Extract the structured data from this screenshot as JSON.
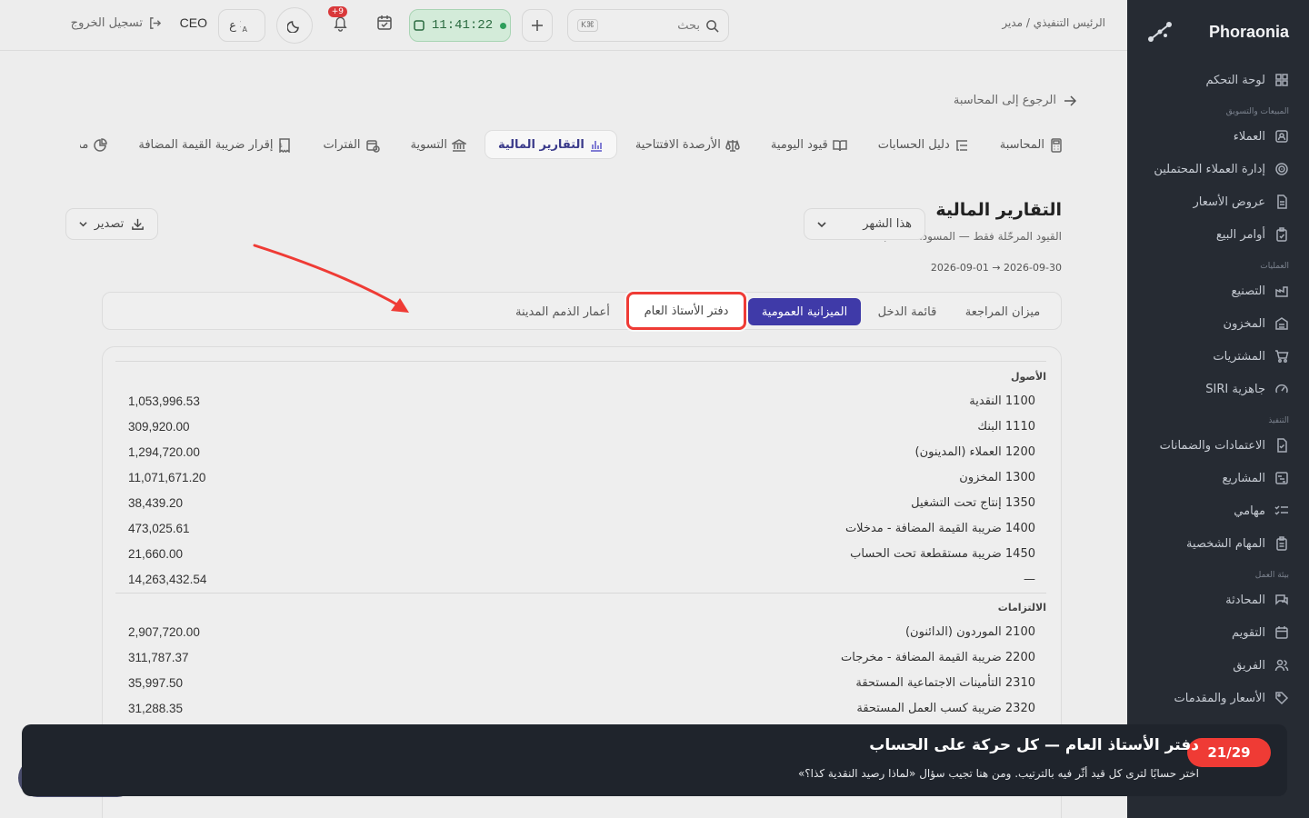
{
  "brand": {
    "name": "Phoraonia"
  },
  "sidebar": {
    "items": [
      {
        "type": "item",
        "label": "لوحة التحكم",
        "icon": "grid-icon"
      },
      {
        "type": "section",
        "label": "المبيعات والتسويق"
      },
      {
        "type": "item",
        "label": "العملاء",
        "icon": "contact-icon"
      },
      {
        "type": "item",
        "label": "إدارة العملاء المحتملين",
        "icon": "target-icon"
      },
      {
        "type": "item",
        "label": "عروض الأسعار",
        "icon": "document-icon"
      },
      {
        "type": "item",
        "label": "أوامر البيع",
        "icon": "clipboard-icon"
      },
      {
        "type": "section",
        "label": "العمليات"
      },
      {
        "type": "item",
        "label": "التصنيع",
        "icon": "factory-icon"
      },
      {
        "type": "item",
        "label": "المخزون",
        "icon": "warehouse-icon"
      },
      {
        "type": "item",
        "label": "المشتريات",
        "icon": "cart-icon"
      },
      {
        "type": "item",
        "label": "جاهزية SIRI",
        "icon": "gauge-icon"
      },
      {
        "type": "section",
        "label": "التنفيذ"
      },
      {
        "type": "item",
        "label": "الاعتمادات والضمانات",
        "icon": "file-check-icon"
      },
      {
        "type": "item",
        "label": "المشاريع",
        "icon": "gantt-icon"
      },
      {
        "type": "item",
        "label": "مهامي",
        "icon": "list-check-icon"
      },
      {
        "type": "item",
        "label": "المهام الشخصية",
        "icon": "clipboard-list-icon"
      },
      {
        "type": "section",
        "label": "بيئة العمل"
      },
      {
        "type": "item",
        "label": "المحادثة",
        "icon": "chat-icon"
      },
      {
        "type": "item",
        "label": "التقويم",
        "icon": "calendar-icon"
      },
      {
        "type": "item",
        "label": "الفريق",
        "icon": "users-icon"
      },
      {
        "type": "item",
        "label": "الأسعار والمقدمات",
        "icon": "tag-icon"
      }
    ]
  },
  "topbar": {
    "breadcrumb": "الرئيس التنفيذي / مدير",
    "search_placeholder": "بحث",
    "search_shortcut": "K⌘",
    "clock": "11:41:22",
    "notif_count": "+9",
    "lang": "ع",
    "role": "CEO",
    "logout": "تسجيل الخروج"
  },
  "nav": {
    "back": "الرجوع إلى المحاسبة",
    "tabs": [
      {
        "label": "المحاسبة",
        "icon": "calculator-icon",
        "active": false
      },
      {
        "label": "دليل الحسابات",
        "icon": "list-tree-icon",
        "active": false
      },
      {
        "label": "قيود اليومية",
        "icon": "book-icon",
        "active": false
      },
      {
        "label": "الأرصدة الافتتاحية",
        "icon": "scale-icon",
        "active": false
      },
      {
        "label": "التقارير المالية",
        "icon": "bar-chart-icon",
        "active": true
      },
      {
        "label": "التسوية",
        "icon": "bank-icon",
        "active": false
      },
      {
        "label": "الفترات",
        "icon": "calendar-clock-icon",
        "active": false
      },
      {
        "label": "إقرار ضريبة القيمة المضافة",
        "icon": "receipt-icon",
        "active": false
      },
      {
        "label": "مد",
        "icon": "pie-icon",
        "active": false
      }
    ]
  },
  "page": {
    "title": "التقارير المالية",
    "subtitle": "القيود المرحّلة فقط — المسودات مستبعدة.",
    "range": "2026-09-01 → 2026-09-30",
    "period": "هذا الشهر",
    "export": "تصدير"
  },
  "report_tabs": [
    {
      "label": "ميزان المراجعة",
      "state": "normal"
    },
    {
      "label": "قائمة الدخل",
      "state": "normal"
    },
    {
      "label": "الميزانية العمومية",
      "state": "active"
    },
    {
      "label": "دفتر الأستاذ العام",
      "state": "highlighted"
    },
    {
      "label": "أعمار الذمم المدينة",
      "state": "normal"
    }
  ],
  "balance_sheet": {
    "assets": {
      "title": "الأصول",
      "rows": [
        {
          "name": "1100 النقدية",
          "value": "1,053,996.53"
        },
        {
          "name": "1110 البنك",
          "value": "309,920.00"
        },
        {
          "name": "1200 العملاء (المدينون)",
          "value": "1,294,720.00"
        },
        {
          "name": "1300 المخزون",
          "value": "11,071,671.20"
        },
        {
          "name": "1350 إنتاج تحت التشغيل",
          "value": "38,439.20"
        },
        {
          "name": "1400 ضريبة القيمة المضافة - مدخلات",
          "value": "473,025.61"
        },
        {
          "name": "1450 ضريبة مستقطعة تحت الحساب",
          "value": "21,660.00"
        }
      ],
      "total_label": "—",
      "total": "14,263,432.54"
    },
    "liabilities": {
      "title": "الالتزامات",
      "rows": [
        {
          "name": "2100 الموردون (الدائنون)",
          "value": "2,907,720.00"
        },
        {
          "name": "2200 ضريبة القيمة المضافة - مخرجات",
          "value": "311,787.37"
        },
        {
          "name": "2310 التأمينات الاجتماعية المستحقة",
          "value": "35,997.50"
        },
        {
          "name": "2320 ضريبة كسب العمل المستحقة",
          "value": "31,288.35"
        }
      ]
    }
  },
  "tour": {
    "step": "21/29",
    "title": "دفتر الأستاذ العام — كل حركة على الحساب",
    "description": "اختر حسابًا لترى كل قيد أثّر فيه بالترتيب. ومن هنا تجيب سؤال «لماذا رصيد النقدية كذا؟»"
  },
  "colors": {
    "sidebar_bg": "#262b33",
    "accent": "#3f3aa8",
    "highlight_red": "#ef3b35",
    "clock_green": "#2e9e5b",
    "toast_bg": "#1f242c"
  }
}
